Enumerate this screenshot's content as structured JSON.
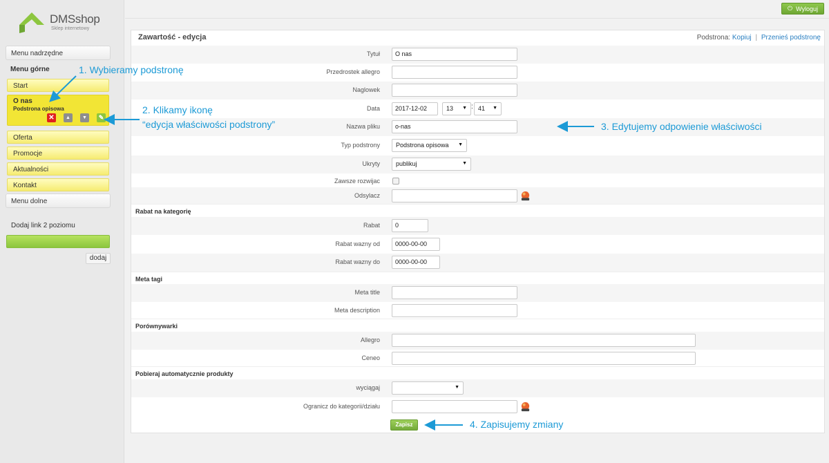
{
  "logo": {
    "name": "DMSshop",
    "subtitle": "Sklep internetowy"
  },
  "topbar": {
    "logout_label": "Wyloguj"
  },
  "sidebar": {
    "menu_parent": "Menu nadrzędne",
    "menu_top": "Menu górne",
    "items": [
      {
        "label": "Start"
      },
      {
        "label": "O nas",
        "sublabel": "Podstrona opisowa",
        "active": true
      },
      {
        "label": "Oferta"
      },
      {
        "label": "Promocje"
      },
      {
        "label": "Aktualności"
      },
      {
        "label": "Kontakt"
      }
    ],
    "menu_bottom": "Menu dolne",
    "add_link_label": "Dodaj link 2 poziomu",
    "add_button": "dodaj"
  },
  "panel": {
    "title": "Zawartość - edycja",
    "subpage_label": "Podstrona:",
    "copy_link": "Kopiuj",
    "separator": "|",
    "move_link": "Przenieś podstronę"
  },
  "form": {
    "tytul": {
      "label": "Tytuł",
      "value": "O nas"
    },
    "przedrostek": {
      "label": "Przedrostek allegro",
      "value": ""
    },
    "naglowek": {
      "label": "Naglowek",
      "value": ""
    },
    "data": {
      "label": "Data",
      "date": "2017-12-02",
      "hour": "13",
      "minute": "41"
    },
    "nazwa_pliku": {
      "label": "Nazwa pliku",
      "value": "o-nas"
    },
    "typ_podstrony": {
      "label": "Typ podstrony",
      "value": "Podstrona opisowa"
    },
    "ukryty": {
      "label": "Ukryty",
      "value": "publikuj"
    },
    "zawsze_rozwijac": {
      "label": "Zawsze rozwijac",
      "checked": false
    },
    "odsylacz": {
      "label": "Odsylacz",
      "value": ""
    }
  },
  "sections": {
    "rabat": {
      "title": "Rabat na kategorię",
      "rabat": {
        "label": "Rabat",
        "value": "0"
      },
      "od": {
        "label": "Rabat wazny od",
        "value": "0000-00-00"
      },
      "do": {
        "label": "Rabat wazny do",
        "value": "0000-00-00"
      }
    },
    "meta": {
      "title": "Meta tagi",
      "meta_title": {
        "label": "Meta title",
        "value": ""
      },
      "meta_description": {
        "label": "Meta description",
        "value": ""
      }
    },
    "porownywarki": {
      "title": "Porównywarki",
      "allegro": {
        "label": "Allegro",
        "value": ""
      },
      "ceneo": {
        "label": "Ceneo",
        "value": ""
      }
    },
    "pobieraj": {
      "title": "Pobieraj automatycznie produkty",
      "wyciagaj": {
        "label": "wyciągaj",
        "value": ""
      },
      "ogranicz": {
        "label": "Ogranicz do kategorii/działu",
        "value": ""
      }
    }
  },
  "save_button": "Zapisz",
  "annotations": {
    "step1": "1. Wybieramy podstronę",
    "step2a": "2. Klikamy ikonę",
    "step2b": "“edycja właściwości podstrony”",
    "step3": "3. Edytujemy odpowienie właściwości",
    "step4": "4. Zapisujemy zmiany"
  },
  "colors": {
    "accent_green": "#8dc63f",
    "menu_yellow": "#f2e535",
    "annotation_blue": "#1c9ad6"
  }
}
